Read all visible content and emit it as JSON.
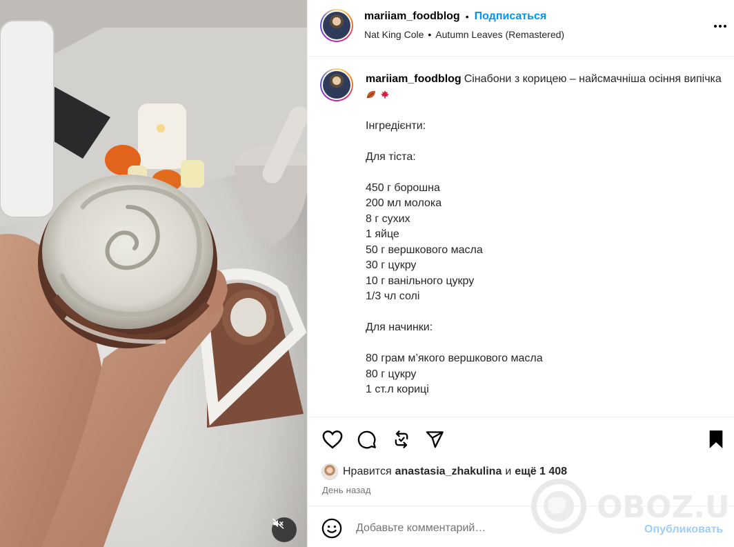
{
  "header": {
    "username": "mariiam_foodblog",
    "separator": "•",
    "follow_label": "Подписаться",
    "audio_artist": "Nat King Cole",
    "audio_separator": "•",
    "audio_track": "Autumn Leaves (Remastered)"
  },
  "caption": {
    "username": "mariiam_foodblog",
    "text": "Сінабони з корицею – найсмачніша осіння випічка",
    "emoji": [
      "leaf-emoji",
      "maple-leaf-emoji"
    ],
    "body": "\nІнгредієнти:\n\nДля тіста:\n\n450 г борошна\n200 мл молока\n8 г сухих\n1 яйце\n50 г вершкового масла\n30 г цукру\n10 г ванільного цукру\n1/3 чл солі\n\nДля начинки:\n\n80 грам м’якого вершкового масла\n80 г цукру\n1 ст.л кориці"
  },
  "likes": {
    "prefix": "Нравится",
    "user": "anastasia_zhakulina",
    "conjunction": "и",
    "more": "ещё 1 408"
  },
  "time": "День назад",
  "comment": {
    "placeholder": "Добавьте комментарий…",
    "post_label": "Опубликовать"
  },
  "watermark": {
    "text": "OBOZ.UA"
  },
  "colors": {
    "accent": "#0095f6",
    "post_disabled": "#9fcdf7",
    "secondary_text": "#737373",
    "divider": "#efefef"
  },
  "icons": [
    "heart-icon",
    "comment-icon",
    "repost-icon",
    "share-icon",
    "bookmark-icon",
    "more-icon",
    "mute-icon",
    "emoji-icon"
  ]
}
